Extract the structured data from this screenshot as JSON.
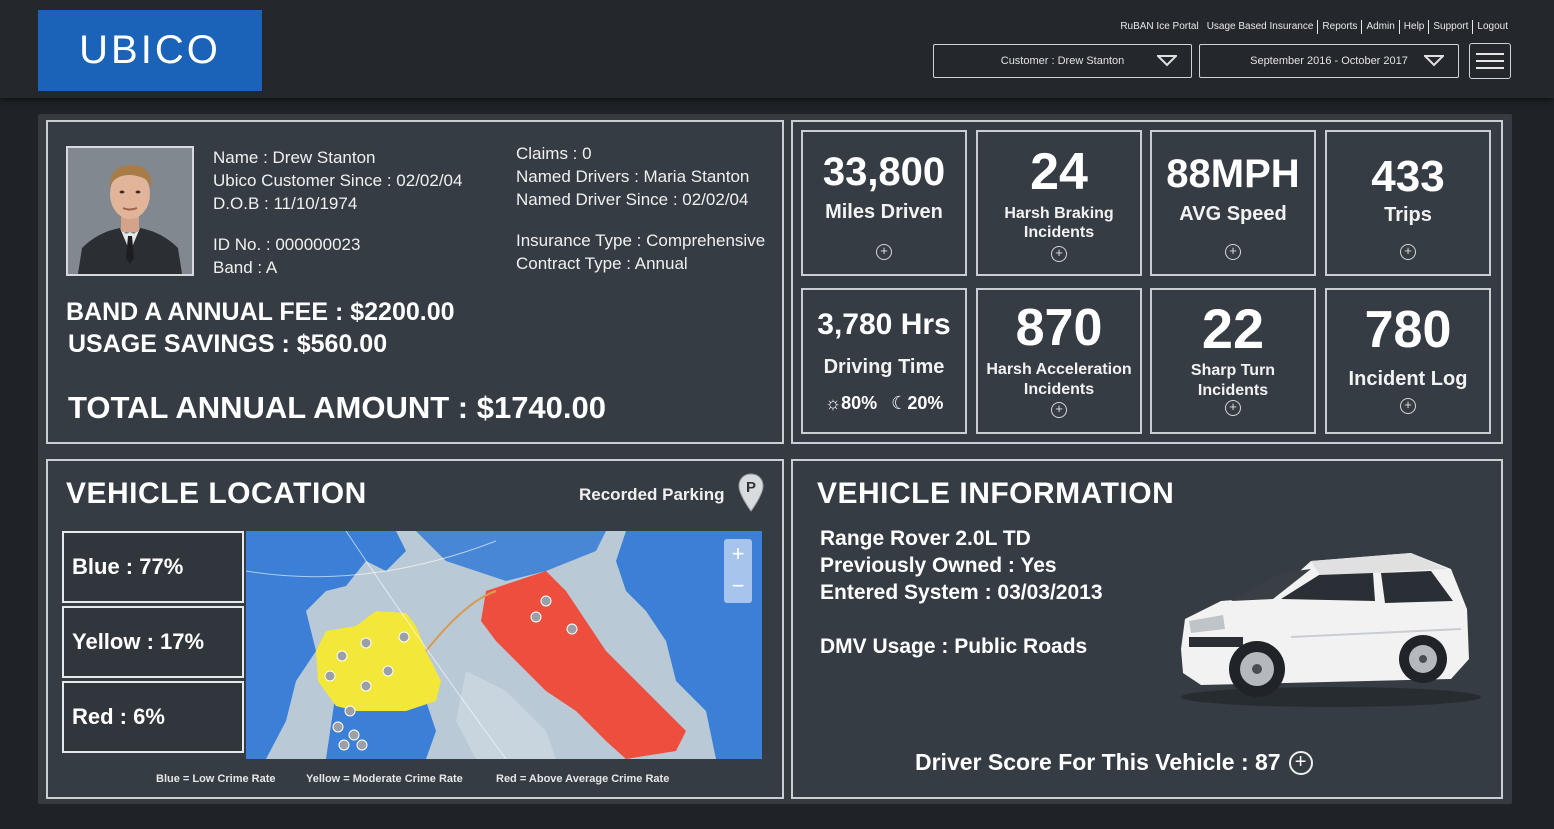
{
  "brand": {
    "logo_text": "UBICO",
    "color": "#1a63b8"
  },
  "top_links": [
    "RuBAN Ice Portal",
    "Usage Based Insurance",
    "Reports",
    "Admin",
    "Help",
    "Support",
    "Logout"
  ],
  "filters": {
    "customer": "Customer : Drew Stanton",
    "date_range": "September 2016 - October 2017"
  },
  "customer": {
    "name": "Name : Drew Stanton",
    "since": "Ubico Customer Since : 02/02/04",
    "dob": "D.O.B : 11/10/1974",
    "id_no": "ID No. : 000000023",
    "band": "Band : A",
    "claims": "Claims : 0",
    "named_drivers": "Named Drivers : Maria Stanton",
    "named_driver_since": "Named Driver Since : 02/02/04",
    "insurance_type": "Insurance Type : Comprehensive",
    "contract_type": "Contract Type : Annual",
    "annual_fee": "BAND A ANNUAL FEE : $2200.00",
    "usage_savings": "USAGE SAVINGS : $560.00",
    "total_amount": "TOTAL ANNUAL AMOUNT : $1740.00"
  },
  "stats": [
    {
      "value": "33,800",
      "label": "Miles Driven"
    },
    {
      "value": "24",
      "label_line1": "Harsh Braking",
      "label_line2": "Incidents"
    },
    {
      "value": "88MPH",
      "label": "AVG Speed"
    },
    {
      "value": "433",
      "label": "Trips"
    },
    {
      "value": "3,780 Hrs",
      "label": "Driving Time",
      "day": "80%",
      "night": "20%"
    },
    {
      "value": "870",
      "label_line1": "Harsh Acceleration",
      "label_line2": "Incidents"
    },
    {
      "value": "22",
      "label_line1": "Sharp Turn",
      "label_line2": "Incidents"
    },
    {
      "value": "780",
      "label": "Incident Log"
    }
  ],
  "location": {
    "title": "VEHICLE LOCATION",
    "recorded_parking": "Recorded Parking",
    "blue": "Blue : 77%",
    "yellow": "Yellow : 17%",
    "red": "Red : 6%",
    "legend_blue": "Blue = Low Crime Rate",
    "legend_yellow": "Yellow = Moderate Crime Rate",
    "legend_red": "Red = Above Average Crime Rate",
    "zoom_in": "+",
    "zoom_out": "−"
  },
  "vehicle": {
    "title": "VEHICLE INFORMATION",
    "model": "Range Rover 2.0L TD",
    "previously_owned": "Previously Owned : Yes",
    "entered_system": "Entered System : 03/03/2013",
    "dmv_usage": "DMV Usage : Public Roads",
    "driver_score": "Driver Score For This Vehicle :  87"
  },
  "colors": {
    "crime_blue": "#3c7fd6",
    "crime_yellow": "#f3e83a",
    "crime_red": "#ee4e3d"
  }
}
